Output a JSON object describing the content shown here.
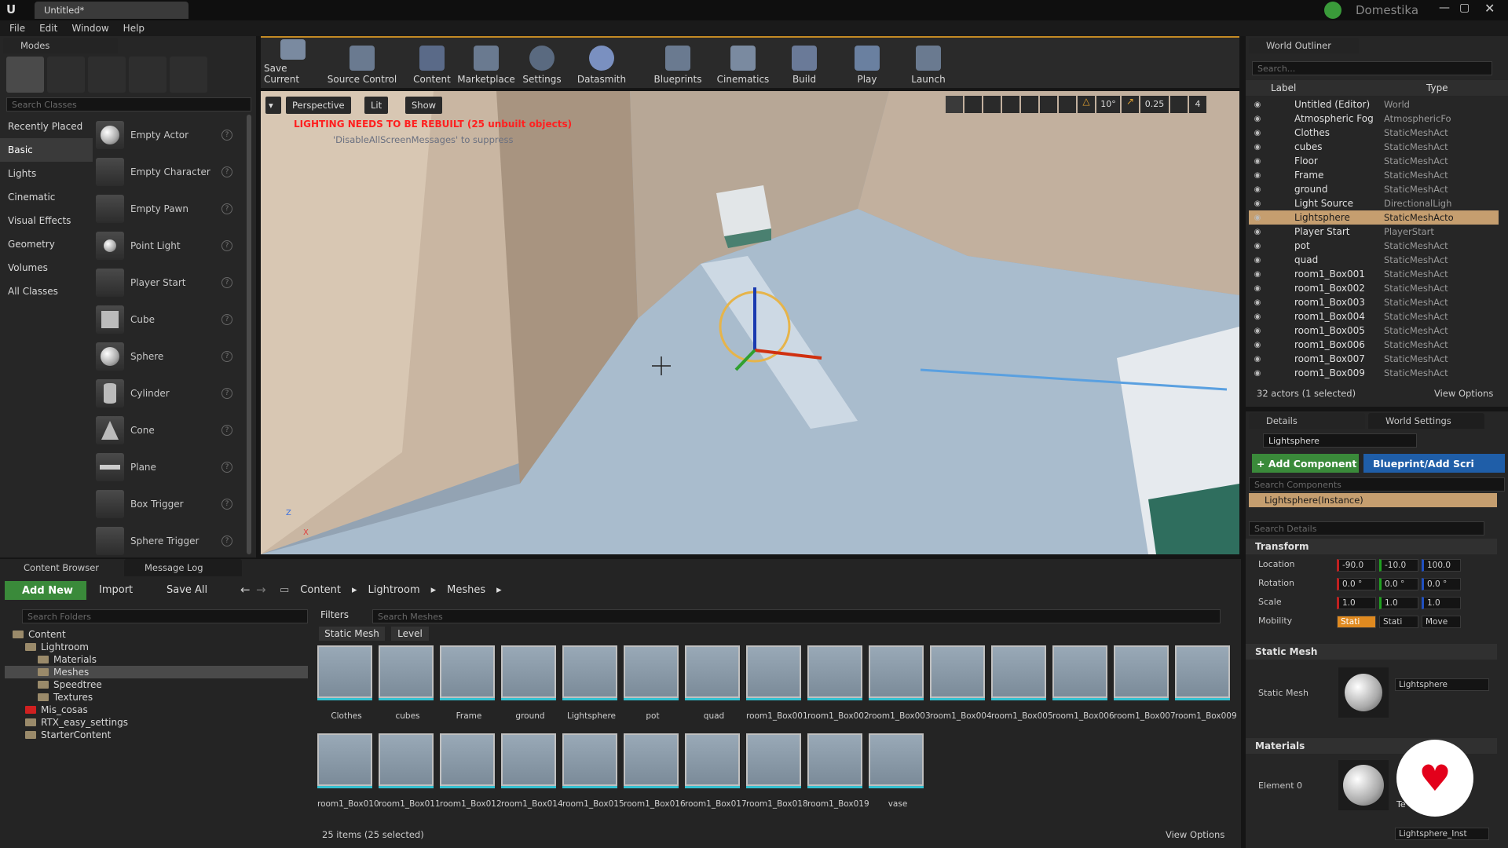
{
  "window": {
    "title": "Untitled*",
    "brand": "Domestika",
    "logo": "U"
  },
  "menu": [
    "File",
    "Edit",
    "Window",
    "Help"
  ],
  "modes": {
    "tab": "Modes",
    "search_placeholder": "Search Classes",
    "categories": [
      "Recently Placed",
      "Basic",
      "Lights",
      "Cinematic",
      "Visual Effects",
      "Geometry",
      "Volumes",
      "All Classes"
    ],
    "active_category": "Basic",
    "items": [
      "Empty Actor",
      "Empty Character",
      "Empty Pawn",
      "Point Light",
      "Player Start",
      "Cube",
      "Sphere",
      "Cylinder",
      "Cone",
      "Plane",
      "Box Trigger",
      "Sphere Trigger"
    ]
  },
  "toolbar": [
    "Save Current",
    "Source Control",
    "Content",
    "Marketplace",
    "Settings",
    "Datasmith",
    "Blueprints",
    "Cinematics",
    "Build",
    "Play",
    "Launch"
  ],
  "viewport": {
    "perspective": "Perspective",
    "lit": "Lit",
    "show": "Show",
    "warning": "LIGHTING NEEDS TO BE REBUILT (25 unbuilt objects)",
    "warning_sub": "'DisableAllScreenMessages' to suppress",
    "angle_snap": "10°",
    "scale_snap": "0.25",
    "camera_speed": "4",
    "axis_z": "Z",
    "axis_x": "X"
  },
  "outliner": {
    "tab": "World Outliner",
    "search_placeholder": "Search...",
    "col_label": "Label",
    "col_type": "Type",
    "rows": [
      {
        "label": "Untitled (Editor)",
        "type": "World"
      },
      {
        "label": "Atmospheric Fog",
        "type": "AtmosphericFo"
      },
      {
        "label": "Clothes",
        "type": "StaticMeshAct"
      },
      {
        "label": "cubes",
        "type": "StaticMeshAct"
      },
      {
        "label": "Floor",
        "type": "StaticMeshAct"
      },
      {
        "label": "Frame",
        "type": "StaticMeshAct"
      },
      {
        "label": "ground",
        "type": "StaticMeshAct"
      },
      {
        "label": "Light Source",
        "type": "DirectionalLigh"
      },
      {
        "label": "Lightsphere",
        "type": "StaticMeshActo"
      },
      {
        "label": "Player Start",
        "type": "PlayerStart"
      },
      {
        "label": "pot",
        "type": "StaticMeshAct"
      },
      {
        "label": "quad",
        "type": "StaticMeshAct"
      },
      {
        "label": "room1_Box001",
        "type": "StaticMeshAct"
      },
      {
        "label": "room1_Box002",
        "type": "StaticMeshAct"
      },
      {
        "label": "room1_Box003",
        "type": "StaticMeshAct"
      },
      {
        "label": "room1_Box004",
        "type": "StaticMeshAct"
      },
      {
        "label": "room1_Box005",
        "type": "StaticMeshAct"
      },
      {
        "label": "room1_Box006",
        "type": "StaticMeshAct"
      },
      {
        "label": "room1_Box007",
        "type": "StaticMeshAct"
      },
      {
        "label": "room1_Box009",
        "type": "StaticMeshAct"
      }
    ],
    "selected_index": 8,
    "footer": "32 actors (1 selected)",
    "view_options": "View Options"
  },
  "details": {
    "tab": "Details",
    "tab2": "World Settings",
    "name": "Lightsphere",
    "add_component": "+ Add Component",
    "blueprint": "Blueprint/Add Scri",
    "search_components": "Search Components",
    "instance": "Lightsphere(Instance)",
    "search_details": "Search Details",
    "transform": "Transform",
    "location_label": "Location",
    "location": [
      "-90.0",
      "-10.0",
      "100.0"
    ],
    "rotation_label": "Rotation",
    "rotation": [
      "0.0 °",
      "0.0 °",
      "0.0 °"
    ],
    "scale_label": "Scale",
    "scale": [
      "1.0",
      "1.0",
      "1.0"
    ],
    "mobility_label": "Mobility",
    "mobility": [
      "Stati",
      "Stati",
      "Move"
    ],
    "static_mesh_section": "Static Mesh",
    "static_mesh_label": "Static Mesh",
    "static_mesh_value": "Lightsphere",
    "materials_section": "Materials",
    "element0": "Element 0",
    "material_value": "Lightsphere_Inst",
    "tex_label": "Te"
  },
  "content_browser": {
    "tab": "Content Browser",
    "tab2": "Message Log",
    "add_new": "Add New",
    "import": "Import",
    "save_all": "Save All",
    "path": [
      "Content",
      "Lightroom",
      "Meshes"
    ],
    "search_folders": "Search Folders",
    "filters": "Filters",
    "search_meshes": "Search Meshes",
    "filter_chips": [
      "Static Mesh",
      "Level"
    ],
    "folders": [
      {
        "name": "Content",
        "depth": 0
      },
      {
        "name": "Lightroom",
        "depth": 1
      },
      {
        "name": "Materials",
        "depth": 2
      },
      {
        "name": "Meshes",
        "depth": 2
      },
      {
        "name": "Speedtree",
        "depth": 2
      },
      {
        "name": "Textures",
        "depth": 2
      },
      {
        "name": "Mis_cosas",
        "depth": 1
      },
      {
        "name": "RTX_easy_settings",
        "depth": 1
      },
      {
        "name": "StarterContent",
        "depth": 1
      }
    ],
    "assets": [
      "Clothes",
      "cubes",
      "Frame",
      "ground",
      "Lightsphere",
      "pot",
      "quad",
      "room1_Box001",
      "room1_Box002",
      "room1_Box003",
      "room1_Box004",
      "room1_Box005",
      "room1_Box006",
      "room1_Box007",
      "room1_Box009",
      "room1_Box010",
      "room1_Box011",
      "room1_Box012",
      "room1_Box014",
      "room1_Box015",
      "room1_Box016",
      "room1_Box017",
      "room1_Box018",
      "room1_Box019",
      "vase"
    ],
    "status": "25 items (25 selected)",
    "view_options": "View Options"
  },
  "colors": {
    "accent_green": "#3a8a3a",
    "selection": "#c59e6f",
    "warning_red": "#e02020",
    "blueprint_blue": "#1f5ea8",
    "domestika_red": "#e3001b"
  }
}
